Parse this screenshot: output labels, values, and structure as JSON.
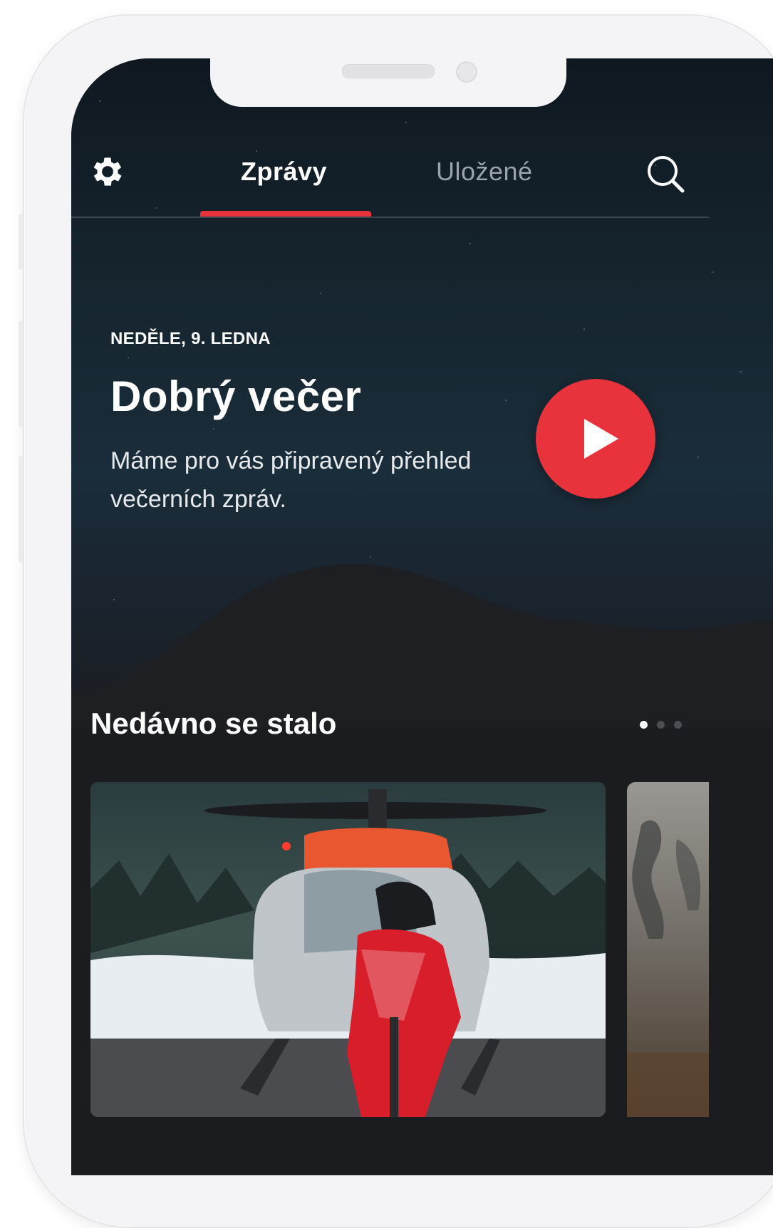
{
  "nav": {
    "tabs": [
      {
        "label": "Zprávy",
        "active": true
      },
      {
        "label": "Uložené",
        "active": false
      }
    ],
    "icons": [
      "gear-icon",
      "search-icon"
    ],
    "accent_color": "#e8323c"
  },
  "hero": {
    "date": "NEDĚLE, 9. LEDNA",
    "greeting": "Dobrý večer",
    "message": "Máme pro vás připravený přehled večerních zpráv.",
    "action_icon": "play-icon"
  },
  "recent": {
    "title": "Nedávno se stalo",
    "pages_total": 3,
    "page_current": 1
  }
}
